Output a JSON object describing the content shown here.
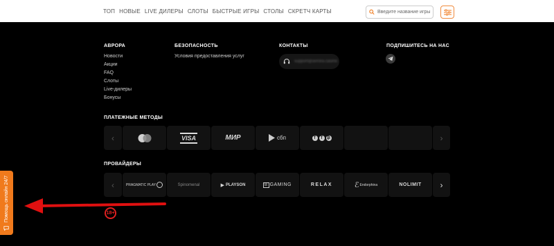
{
  "topnav": {
    "items": [
      "ТОП",
      "НОВЫЕ",
      "LIVE ДИЛЕРЫ",
      "СЛОТЫ",
      "БЫСТРЫЕ ИГРЫ",
      "СТОЛЫ",
      "СКРЕТЧ КАРТЫ"
    ],
    "search_placeholder": "Введите название игры"
  },
  "footer": {
    "avrora": {
      "title": "АВРОРА",
      "links": [
        "Новости",
        "Акции",
        "FAQ",
        "Слоты",
        "Live-дилеры",
        "Бонусы"
      ]
    },
    "security": {
      "title": "БЕЗОПАСНОСТЬ",
      "links": [
        "Условия предоставления услуг"
      ]
    },
    "contacts": {
      "title": "КОНТАКТЫ",
      "email": "support@avrora.casino"
    },
    "subscribe": {
      "title": "ПОДПИШИТЕСЬ НА НАС"
    }
  },
  "payments": {
    "title": "ПЛАТЕЖНЫЕ МЕТОДЫ",
    "items": [
      "mastercard-icon",
      "VISA",
      "МИР",
      "сбп",
      "crypto-icons",
      "",
      ""
    ]
  },
  "providers": {
    "title": "ПРОВАЙДЕРЫ",
    "items": [
      "PRAGMATIC PLAY",
      "Spinomenal",
      "PLAYSON",
      "GAMING",
      "RELAX",
      "Endorphina",
      "NOLIMIT"
    ]
  },
  "help": {
    "label": "Помощь онлайн 24/7"
  },
  "age_badge": "18+",
  "colors": {
    "accent": "#f07a1c",
    "arrow": "#e01010",
    "background": "#000000"
  }
}
